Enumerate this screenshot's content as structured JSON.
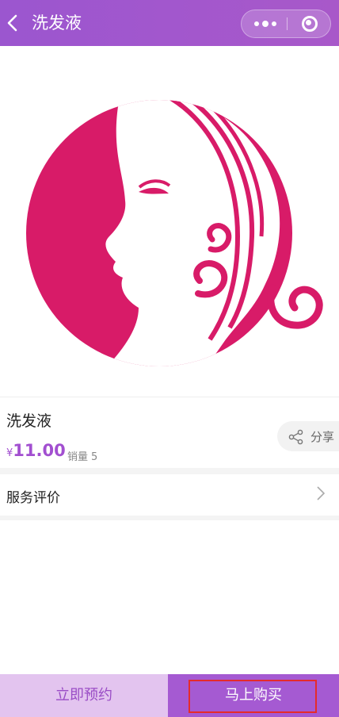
{
  "header": {
    "title": "洗发液",
    "background": "#a257cd"
  },
  "product": {
    "image_icon": "woman-profile-logo",
    "name": "洗发液",
    "currency": "¥",
    "price": "11.00",
    "sales_label": "销量",
    "sales_count": "5",
    "share_label": "分享",
    "accent_color": "#a24fd0"
  },
  "review": {
    "label": "服务评价"
  },
  "bottom_bar": {
    "reserve_label": "立即预约",
    "buy_label": "马上购买"
  }
}
